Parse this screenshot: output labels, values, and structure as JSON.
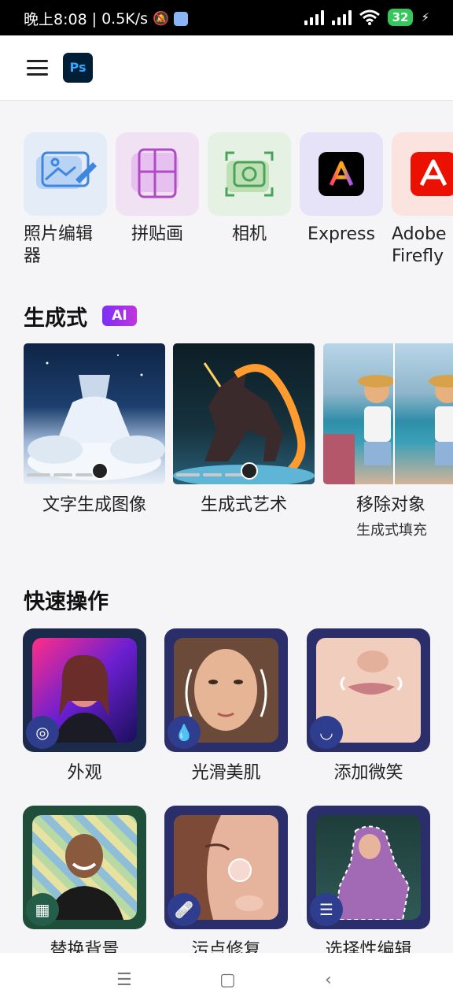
{
  "status": {
    "time": "晚上8:08",
    "speed": "0.5K/s",
    "battery": "32"
  },
  "app": {
    "logo": "Ps"
  },
  "tools": [
    {
      "label": "照片编辑器",
      "icon": "photo-edit-icon"
    },
    {
      "label": "拼贴画",
      "icon": "collage-icon"
    },
    {
      "label": "相机",
      "icon": "camera-icon"
    },
    {
      "label": "Express",
      "icon": "adobe-express-icon"
    },
    {
      "label": "Adobe Firefly",
      "icon": "adobe-firefly-icon"
    }
  ],
  "generative": {
    "title": "生成式",
    "badge": "AI",
    "cards": [
      {
        "title": "文字生成图像",
        "sub": ""
      },
      {
        "title": "生成式艺术",
        "sub": ""
      },
      {
        "title": "移除对象",
        "sub": "生成式填充"
      }
    ]
  },
  "quick": {
    "title": "快速操作",
    "items": [
      {
        "label": "外观",
        "icon": "filters-icon"
      },
      {
        "label": "光滑美肌",
        "icon": "droplet-icon"
      },
      {
        "label": "添加微笑",
        "icon": "smile-icon"
      },
      {
        "label": "替换背景",
        "icon": "background-grid-icon"
      },
      {
        "label": "污点修复",
        "icon": "bandage-icon"
      },
      {
        "label": "选择性编辑",
        "icon": "sliders-icon"
      }
    ]
  },
  "colors": {
    "accent": "#2f3d8f",
    "ai_badge": "#7b2ff7",
    "ps_bg": "#001e36",
    "ps_text": "#31a8ff"
  }
}
